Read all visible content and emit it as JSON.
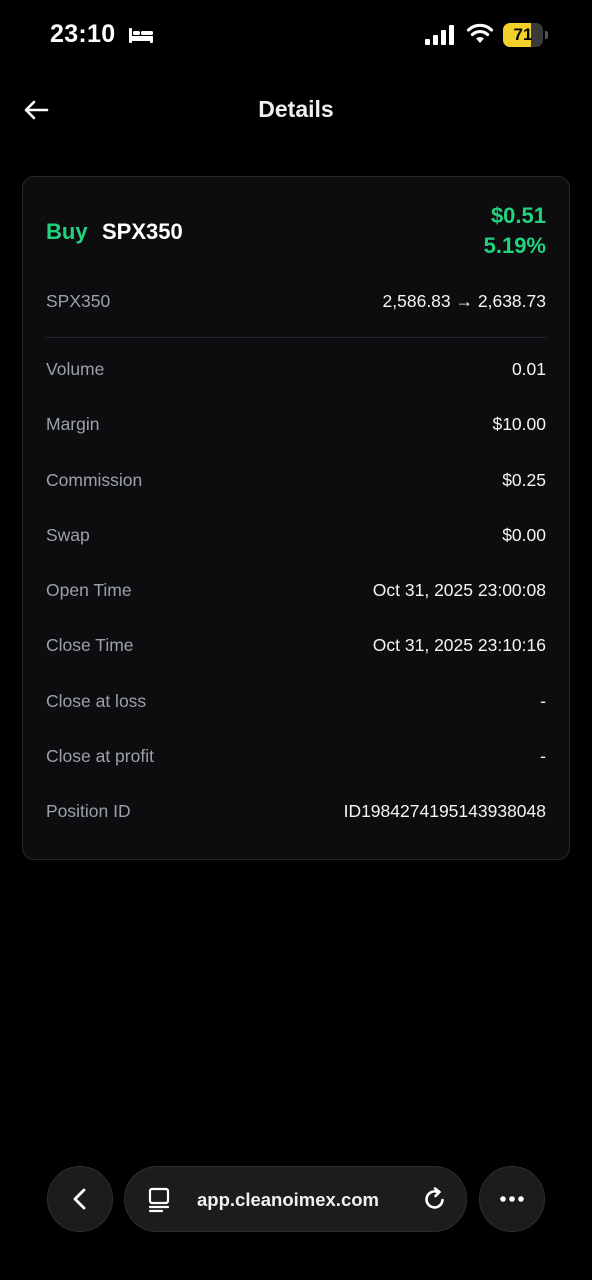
{
  "status": {
    "time": "23:10",
    "battery": "71",
    "battery_level": 0.71
  },
  "header": {
    "title": "Details"
  },
  "trade": {
    "side": "Buy",
    "symbol": "SPX350",
    "pnl_amount": "$0.51",
    "pnl_percent": "5.19%",
    "price_label": "SPX350",
    "price_change": "2,586.83 → 2,638.73"
  },
  "details": [
    {
      "label": "Volume",
      "value": "0.01"
    },
    {
      "label": "Margin",
      "value": "$10.00"
    },
    {
      "label": "Commission",
      "value": "$0.25"
    },
    {
      "label": "Swap",
      "value": "$0.00"
    },
    {
      "label": "Open Time",
      "value": "Oct 31, 2025 23:00:08"
    },
    {
      "label": "Close Time",
      "value": "Oct 31, 2025 23:10:16"
    },
    {
      "label": "Close at loss",
      "value": "-"
    },
    {
      "label": "Close at profit",
      "value": "-"
    },
    {
      "label": "Position ID",
      "value": "ID1984274195143938048"
    }
  ],
  "browser": {
    "url": "app.cleanoimex.com"
  },
  "colors": {
    "accent_green": "#20d37d",
    "battery_yellow": "#f2d12b",
    "background": "#000000",
    "card": "#0d0d0f"
  },
  "icons": [
    "bed-icon",
    "signal-icon",
    "wifi-icon",
    "battery-icon",
    "back-arrow-icon",
    "chevron-left-icon",
    "page-icon",
    "reload-icon",
    "more-icon"
  ]
}
